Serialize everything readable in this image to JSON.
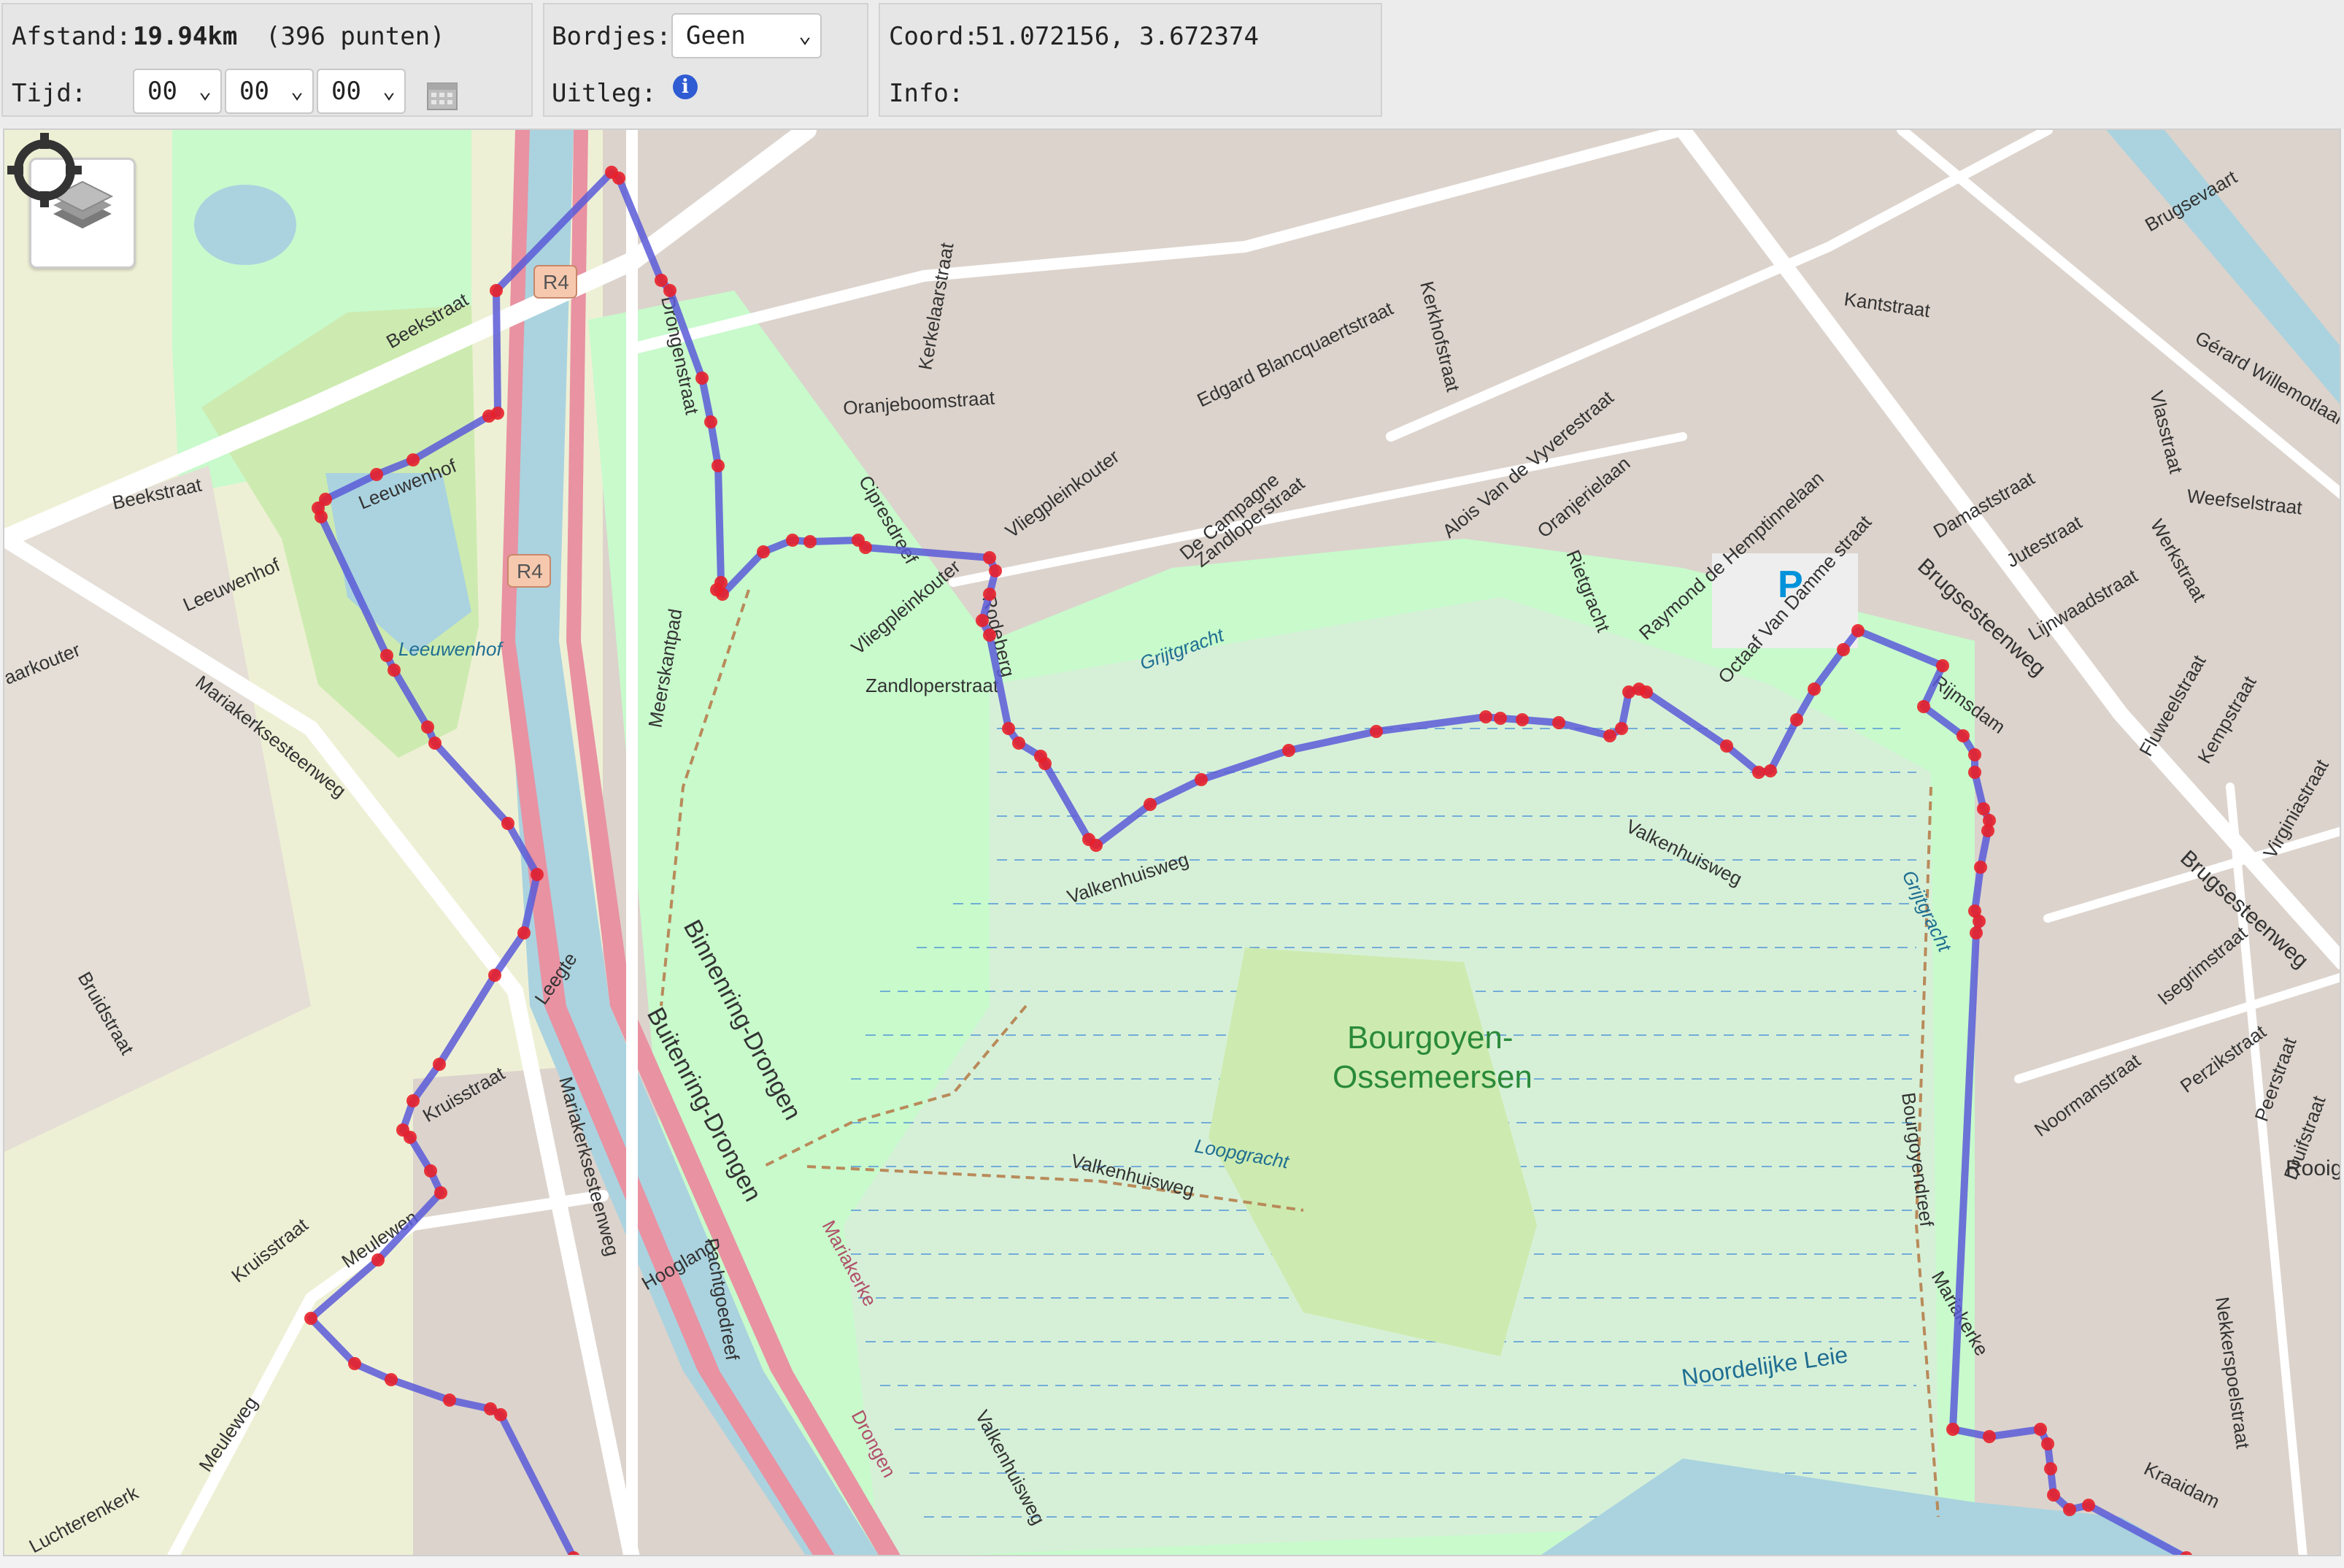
{
  "toolbar": {
    "distance": {
      "label": "Afstand:",
      "value": "19.94km",
      "points": "(396 punten)"
    },
    "time": {
      "label": "Tijd:",
      "hours": "00",
      "minutes": "00",
      "seconds": "00"
    },
    "signs": {
      "label": "Bordjes:",
      "selected": "Geen"
    },
    "legend": {
      "label": "Uitleg:"
    },
    "coords": {
      "label": "Coord:",
      "value": "51.072156, 3.672374"
    },
    "info": {
      "label": "Info:",
      "value": ""
    }
  },
  "icons": {
    "calendar": "calendar-icon",
    "info": "info-icon",
    "layers": "layers-icon",
    "locate": "crosshair-icon",
    "chevron": "chevron-down-icon"
  },
  "colors": {
    "route": "#5a5ad8",
    "route_point": "#e8202a",
    "water": "#aad3df",
    "park": "#c8facc",
    "wetland": "#d4edc4",
    "road_motorway": "#e892a2",
    "residential": "#dcd3cc"
  },
  "map": {
    "shields": [
      "R4",
      "R4"
    ],
    "labels": {
      "beekstraat_a": "Beekstraat",
      "beekstraat_b": "Beekstraat",
      "leeuwenhof_a": "Leeuwenhof",
      "leeuwenhof_b": "Leeuwenhof",
      "leeuwenhof_lake": "Leeuwenhof",
      "mariakerk_stwg_a": "Mariakerksesteenweg",
      "mariakerk_stwg_b": "Mariakerksesteenweg",
      "bruidstraat": "Bruidstraat",
      "kruisstraat_a": "Kruisstraat",
      "kruisstraat_b": "Kruisstraat",
      "meulewen": "Meulewen",
      "meuleweg": "Meuleweg",
      "leegte": "Leegte",
      "hoogland": "Hoogland",
      "pachtgoedreef": "Pachtgoedreef",
      "binnenring": "Binnenring-Drongen",
      "buitenring": "Buitenring-Drongen",
      "mariakerke_drongen": "Mariakerke",
      "drongen": "Drongen",
      "valkenhuisweg_a": "Valkenhuisweg",
      "valkenhuisweg_b": "Valkenhuisweg",
      "valkenhuisweg_c": "Valkenhuisweg",
      "valkenhuisweg_d": "Valkenhuisweg",
      "meersstraatpad": "Meerskantpad",
      "oranjeboomstraat": "Oranjeboomstraat",
      "cipresdreef": "Cipresdreef",
      "kerkelaarstraat": "Kerkelaarstraat",
      "vliegpleinkouter_a": "Vliegpleinkouter",
      "vliegpleinkouter_b": "Vliegpleinkouter",
      "rodeberg": "Rodeberg",
      "zandloperstraat_a": "Zandloperstraat",
      "zandloperstraat_b": "Zandloperstraat",
      "de_campagne": "De Campagne",
      "edgard": "Edgard Blancquaertstraat",
      "alois": "Alois Van de Vyverestraat",
      "oranjerielaan": "Oranjerielaan",
      "rietgracht": "Rietgracht",
      "raymond": "Raymond de Hemptinnelaan",
      "octaaf": "Octaaf Van Damme straat",
      "kerkhofstraat": "Kerkhofstraat",
      "kantstraat": "Kantstraat",
      "brugsesteenweg_a": "Brugsesteenweg",
      "brugsesteenweg_b": "Brugsesteenweg",
      "brugsevaart": "Brugsevaart",
      "gerard": "Gérard Willemotlaan",
      "vlasstraat": "Vlasstraat",
      "weefselstraat": "Weefselstraat",
      "damaststraat": "Damaststraat",
      "jutestraat": "Jutestraat",
      "lijnwaadstraat": "Lijnwaadstraat",
      "werkstraat": "Werkstraat",
      "rijmsdam": "Rijmsdam",
      "fluweelstraat": "Fluweelstraat",
      "kempstraat": "Kempstraat",
      "virginiastraat": "Virginiastraat",
      "isegrimstraat": "Isegrimstraat",
      "noormanstraat": "Noormanstraat",
      "perzikstraat": "Perzikstraat",
      "peerstraat": "Peerstraat",
      "druifstraat": "Druifstraat",
      "rooige": "Rooige",
      "nekkerspoelstraat": "Nekkerspoelstraat",
      "kraaidam": "Kraaidam",
      "grijtgracht_a": "Grijtgracht",
      "grijtgracht_b": "Grijtgracht",
      "bourgoyen_a": "Bourgoyen-",
      "bourgoyen_b": "Ossemeersen",
      "bourgoyendreef": "Bourgoyendreef",
      "loopgracht": "Loopgracht",
      "noordelijke_leie": "Noordelijke Leie",
      "mariakerke_b": "Mariakerke",
      "luchterenkerk": "Luchterenkerk",
      "aarkouter": "aarkouter",
      "gentstraat": "Drongenstraat",
      "parking": "P"
    }
  }
}
